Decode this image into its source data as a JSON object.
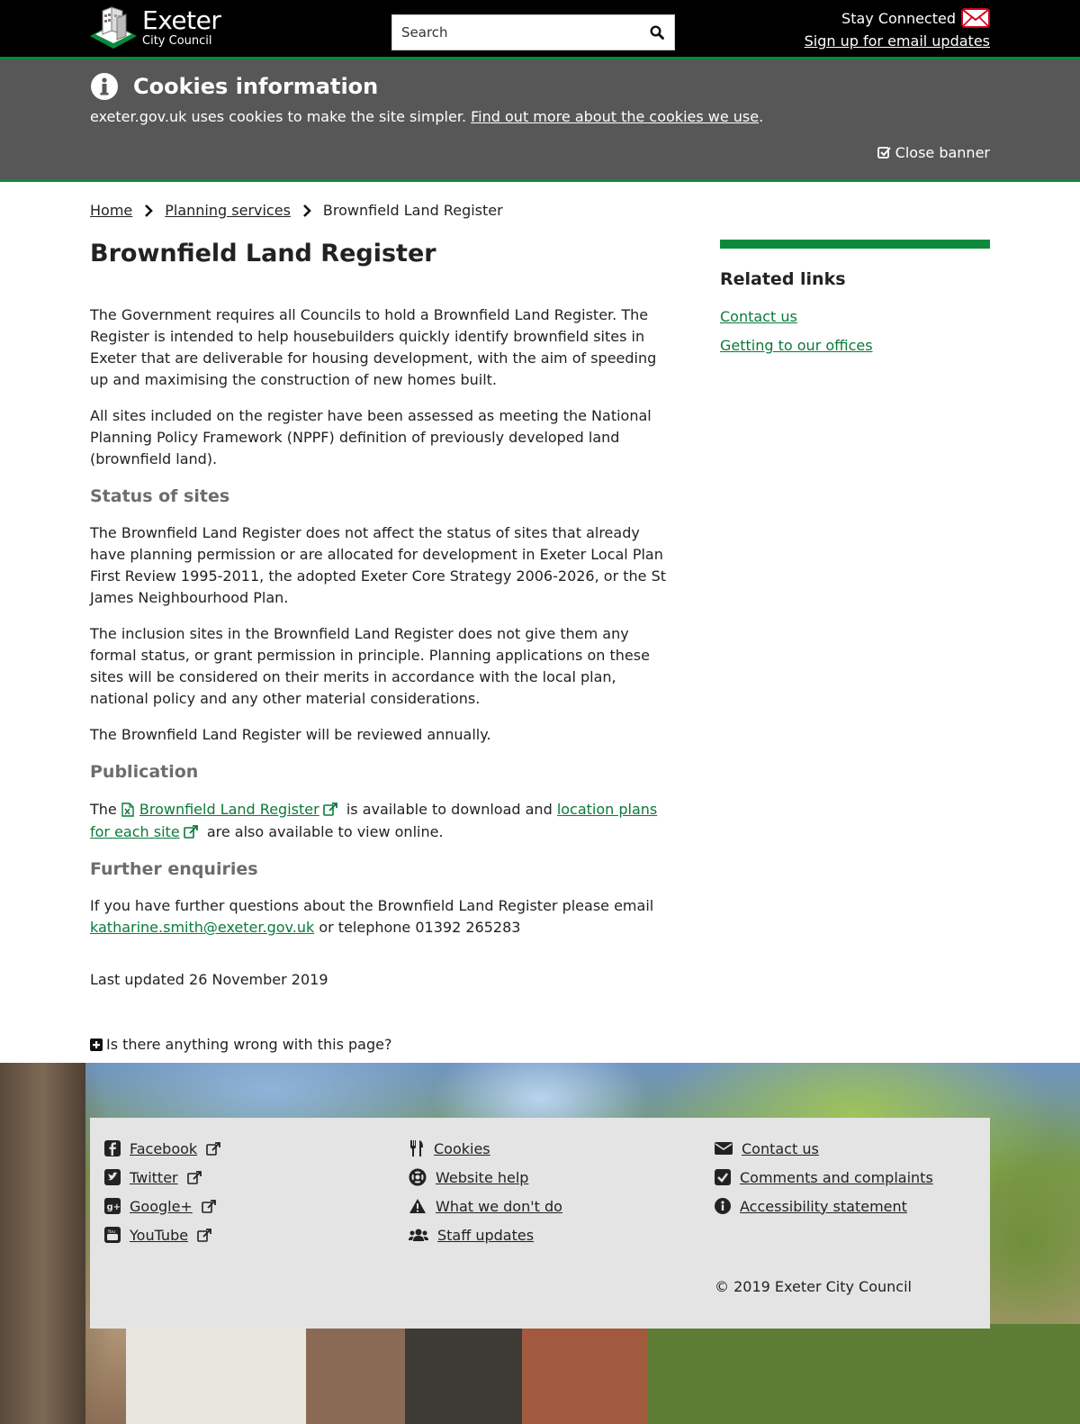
{
  "header": {
    "logo": {
      "line1": "Exeter",
      "line2": "City Council"
    },
    "search_placeholder": "Search",
    "stay_connected": "Stay Connected",
    "signup": "Sign up for email updates"
  },
  "cookie_banner": {
    "title": "Cookies information",
    "text": "exeter.gov.uk uses cookies to make the site simpler.",
    "link": "Find out more about the cookies we use",
    "link_suffix": ".",
    "close": "Close banner"
  },
  "breadcrumb": {
    "home": "Home",
    "parent": "Planning services",
    "current": "Brownfield Land Register"
  },
  "main": {
    "title": "Brownfield Land Register",
    "intro1": "The Government requires all Councils to hold a Brownfield Land Register. The Register is intended to help housebuilders quickly identify brownfield sites in Exeter that are deliverable for housing development, with the aim of speeding up and maximising the construction of new homes built.",
    "intro2": "All sites included on the register have been assessed as meeting the National Planning Policy Framework (NPPF) definition of previously developed land (brownfield land).",
    "status_heading": "Status of sites",
    "status1": "The Brownfield Land Register does not affect the status of sites that already have planning permission or are allocated for development in Exeter Local Plan First Review 1995-2011, the adopted Exeter Core Strategy 2006-2026, or the St James Neighbourhood Plan.",
    "status2": "The inclusion sites in the Brownfield Land Register does not give them any formal status, or grant permission in principle. Planning applications on these sites will be considered on their merits in accordance with the local plan, national policy and any other material considerations.",
    "status3": "The Brownfield Land Register will be reviewed annually.",
    "publication_heading": "Publication",
    "pub_prefix": "The",
    "pub_link1": "Brownfield Land Register",
    "pub_middle": "is available to download and",
    "pub_link2": "location plans for each site",
    "pub_suffix": "are also available to view online.",
    "enquiries_heading": "Further enquiries",
    "enq_text": "If you have further questions about the Brownfield Land Register please email",
    "enq_email": "katharine.smith@exeter.gov.uk",
    "enq_phone": "or telephone 01392 265283",
    "last_updated": "Last updated 26 November 2019",
    "wrong": "Is there anything wrong with this page?"
  },
  "sidebar": {
    "title": "Related links",
    "links": [
      "Contact us",
      "Getting to our offices"
    ]
  },
  "footer": {
    "col1": [
      "Facebook",
      "Twitter",
      "Google+",
      "YouTube"
    ],
    "col2": [
      "Cookies",
      "Website help",
      "What we don't do",
      "Staff updates"
    ],
    "col3": [
      "Contact us",
      "Comments and complaints",
      "Accessibility statement"
    ],
    "copyright": "© 2019 Exeter City Council"
  },
  "colors": {
    "brand_green": "#0b8a3e",
    "link_green": "#0b7a3a",
    "banner_grey": "#575757",
    "footer_box": "#e4e4e4"
  }
}
